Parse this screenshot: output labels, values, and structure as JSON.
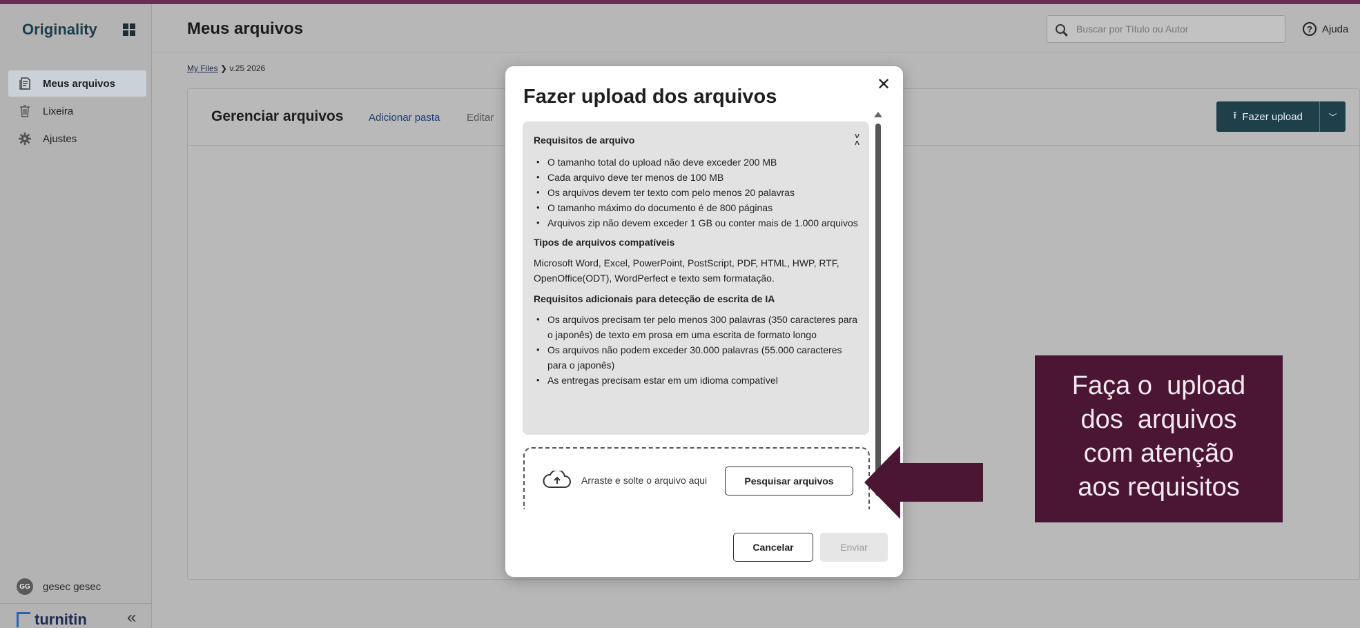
{
  "app": {
    "brand": "Originality"
  },
  "sidebar": {
    "items": [
      {
        "label": "Meus arquivos",
        "icon": "files-icon",
        "active": true
      },
      {
        "label": "Lixeira",
        "icon": "trash-icon",
        "active": false
      },
      {
        "label": "Ajustes",
        "icon": "gear-icon",
        "active": false
      }
    ],
    "user": {
      "initials": "GG",
      "name": "gesec gesec"
    },
    "footer_logo": "turnitin"
  },
  "header": {
    "title": "Meus arquivos",
    "search_placeholder": "Buscar por Título ou Autor",
    "help_label": "Ajuda"
  },
  "breadcrumb": {
    "root": "My Files",
    "current": "v.25 2026"
  },
  "card": {
    "title": "Gerenciar arquivos",
    "add_folder": "Adicionar pasta",
    "edit": "Editar",
    "upload_button": "Fazer upload"
  },
  "modal": {
    "title": "Fazer upload dos arquivos",
    "requirements_title": "Requisitos de arquivo",
    "requirements": [
      "O tamanho total do upload não deve exceder 200 MB",
      "Cada arquivo deve ter menos de 100 MB",
      "Os arquivos devem ter texto com pelo menos 20 palavras",
      "O tamanho máximo do documento é de 800 páginas",
      "Arquivos zip não devem exceder 1 GB ou conter mais de 1.000 arquivos"
    ],
    "types_title": "Tipos de arquivos compatíveis",
    "types_text": "Microsoft Word, Excel, PowerPoint, PostScript, PDF, HTML, HWP, RTF, OpenOffice(ODT), WordPerfect e texto sem formatação.",
    "ai_title": "Requisitos adicionais para detecção de escrita de IA",
    "ai_requirements": [
      "Os arquivos precisam ter pelo menos 300 palavras (350 caracteres para o japonês) de texto em prosa em uma escrita de formato longo",
      "Os arquivos não podem exceder 30.000 palavras (55.000 caracteres para o japonês)",
      "As entregas precisam estar em um idioma compatível"
    ],
    "drop_text": "Arraste e solte o arquivo aqui",
    "browse_button": "Pesquisar arquivos",
    "cancel_button": "Cancelar",
    "send_button": "Enviar"
  },
  "annotation": {
    "lines": [
      "Faça o  upload",
      "dos  arquivos",
      "com atenção",
      "aos requisitos"
    ],
    "color": "#4b1534"
  }
}
